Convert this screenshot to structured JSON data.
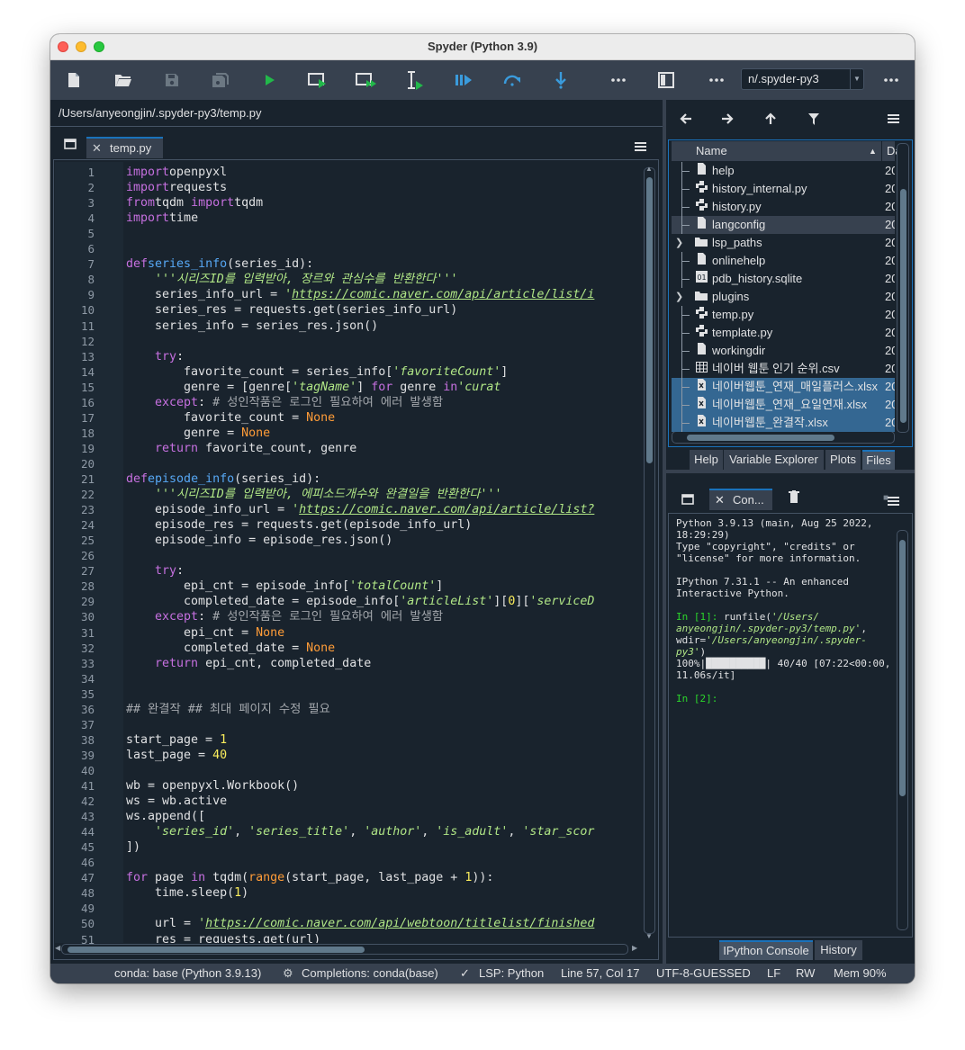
{
  "window": {
    "title": "Spyder (Python 3.9)"
  },
  "toolbar": {
    "working_dir": "n/.spyder-py3"
  },
  "editor": {
    "path": "/Users/anyeongjin/.spyder-py3/temp.py",
    "tab_label": "temp.py",
    "lines": [
      [
        [
          "kw",
          "import"
        ],
        [
          "",
          "openpyxl"
        ]
      ],
      [
        [
          "kw",
          "import"
        ],
        [
          "",
          "requests"
        ]
      ],
      [
        [
          "kw",
          "from"
        ],
        [
          "",
          "tqdm "
        ],
        [
          "kw",
          "import"
        ],
        [
          "",
          "tqdm"
        ]
      ],
      [
        [
          "kw",
          "import"
        ],
        [
          "",
          "time"
        ]
      ],
      [],
      [],
      [
        [
          "kw",
          "def"
        ],
        [
          "fn",
          "series_info"
        ],
        [
          "",
          "(series_id):"
        ]
      ],
      [
        [
          "",
          "    "
        ],
        [
          "st",
          "'''시리즈ID를 입력받아, 장르와 관심수를 반환한다'''"
        ]
      ],
      [
        [
          "",
          "    series_info_url = "
        ],
        [
          "st",
          "'"
        ],
        [
          "st url",
          "https://comic.naver.com/api/article/list/i"
        ]
      ],
      [
        [
          "",
          "    series_res = requests.get(series_info_url)"
        ]
      ],
      [
        [
          "",
          "    series_info = series_res.json()"
        ]
      ],
      [],
      [
        [
          "",
          "    "
        ],
        [
          "kw",
          "try"
        ],
        [
          "",
          ":"
        ]
      ],
      [
        [
          "",
          "        favorite_count = series_info["
        ],
        [
          "st",
          "'favoriteCount'"
        ],
        [
          "",
          "]"
        ]
      ],
      [
        [
          "",
          "        genre = [genre["
        ],
        [
          "st",
          "'tagName'"
        ],
        [
          "",
          "] "
        ],
        [
          "kw",
          "for"
        ],
        [
          "",
          " genre "
        ],
        [
          "kw",
          "in"
        ],
        [
          "",
          "",
          " series_info["
        ],
        [
          "st",
          "'curat"
        ]
      ],
      [
        [
          "",
          "    "
        ],
        [
          "kw",
          "except"
        ],
        [
          "",
          ": "
        ],
        [
          "cm",
          "# 성인작품은 로그인 필요하여 에러 발생함"
        ]
      ],
      [
        [
          "",
          "        favorite_count = "
        ],
        [
          "bu",
          "None"
        ]
      ],
      [
        [
          "",
          "        genre = "
        ],
        [
          "bu",
          "None"
        ]
      ],
      [
        [
          "",
          "    "
        ],
        [
          "kw",
          "return"
        ],
        [
          "",
          " favorite_count, genre"
        ]
      ],
      [],
      [
        [
          "kw",
          "def"
        ],
        [
          "fn",
          "episode_info"
        ],
        [
          "",
          "(series_id):"
        ]
      ],
      [
        [
          "",
          "    "
        ],
        [
          "st",
          "'''시리즈ID를 입력받아, 에피소드개수와 완결일을 반환한다'''"
        ]
      ],
      [
        [
          "",
          "    episode_info_url = "
        ],
        [
          "st",
          "'"
        ],
        [
          "st url",
          "https://comic.naver.com/api/article/list?"
        ]
      ],
      [
        [
          "",
          "    episode_res = requests.get(episode_info_url)"
        ]
      ],
      [
        [
          "",
          "    episode_info = episode_res.json()"
        ]
      ],
      [],
      [
        [
          "",
          "    "
        ],
        [
          "kw",
          "try"
        ],
        [
          "",
          ":"
        ]
      ],
      [
        [
          "",
          "        epi_cnt = episode_info["
        ],
        [
          "st",
          "'totalCount'"
        ],
        [
          "",
          "]"
        ]
      ],
      [
        [
          "",
          "        completed_date = episode_info["
        ],
        [
          "st",
          "'articleList'"
        ],
        [
          "",
          "]["
        ],
        [
          "nu",
          "0"
        ],
        [
          "",
          "]["
        ],
        [
          "st",
          "'serviceD"
        ]
      ],
      [
        [
          "",
          "    "
        ],
        [
          "kw",
          "except"
        ],
        [
          "",
          ": "
        ],
        [
          "cm",
          "# 성인작품은 로그인 필요하여 에러 발생함"
        ]
      ],
      [
        [
          "",
          "        epi_cnt = "
        ],
        [
          "bu",
          "None"
        ]
      ],
      [
        [
          "",
          "        completed_date = "
        ],
        [
          "bu",
          "None"
        ]
      ],
      [
        [
          "",
          "    "
        ],
        [
          "kw",
          "return"
        ],
        [
          "",
          " epi_cnt, completed_date"
        ]
      ],
      [],
      [],
      [
        [
          "cm",
          "## 완결작 ## 최대 페이지 수정 필요"
        ]
      ],
      [],
      [
        [
          "",
          "start_page = "
        ],
        [
          "nu",
          "1"
        ]
      ],
      [
        [
          "",
          "last_page = "
        ],
        [
          "nu",
          "40"
        ]
      ],
      [],
      [
        [
          "",
          "wb = openpyxl.Workbook()"
        ]
      ],
      [
        [
          "",
          "ws = wb.active"
        ]
      ],
      [
        [
          "",
          "ws.append(["
        ]
      ],
      [
        [
          "",
          "    "
        ],
        [
          "st",
          "'series_id'"
        ],
        [
          "",
          ", "
        ],
        [
          "st",
          "'series_title'"
        ],
        [
          "",
          ", "
        ],
        [
          "st",
          "'author'"
        ],
        [
          "",
          ", "
        ],
        [
          "st",
          "'is_adult'"
        ],
        [
          "",
          ", "
        ],
        [
          "st",
          "'star_scor"
        ]
      ],
      [
        [
          "",
          "])"
        ]
      ],
      [],
      [
        [
          "kw",
          "for"
        ],
        [
          "",
          " page "
        ],
        [
          "kw",
          "in"
        ],
        [
          "",
          " tqdm("
        ],
        [
          "bu",
          "range"
        ],
        [
          "",
          "(start_page, last_page + "
        ],
        [
          "nu",
          "1"
        ],
        [
          "",
          "))"
        ],
        [
          "",
          ":"
        ]
      ],
      [
        [
          "",
          "    time.sleep("
        ],
        [
          "nu",
          "1"
        ],
        [
          "",
          ")"
        ]
      ],
      [],
      [
        [
          "",
          "    url = "
        ],
        [
          "st",
          "'"
        ],
        [
          "st url",
          "https://comic.naver.com/api/webtoon/titlelist/finished"
        ]
      ],
      [
        [
          "",
          "    res = requests.get(url)"
        ]
      ]
    ]
  },
  "files": {
    "col_name": "Name",
    "col_date": "Da",
    "items": [
      {
        "name": "help",
        "icon": "file",
        "date": "20"
      },
      {
        "name": "history_internal.py",
        "icon": "python",
        "date": "20"
      },
      {
        "name": "history.py",
        "icon": "python",
        "date": "20"
      },
      {
        "name": "langconfig",
        "icon": "file",
        "date": "20"
      },
      {
        "name": "lsp_paths",
        "icon": "folder",
        "date": "20"
      },
      {
        "name": "onlinehelp",
        "icon": "file",
        "date": "20"
      },
      {
        "name": "pdb_history.sqlite",
        "icon": "db",
        "date": "20"
      },
      {
        "name": "plugins",
        "icon": "folder",
        "date": "20"
      },
      {
        "name": "temp.py",
        "icon": "python",
        "date": "20"
      },
      {
        "name": "template.py",
        "icon": "python",
        "date": "20"
      },
      {
        "name": "workingdir",
        "icon": "file",
        "date": "20"
      },
      {
        "name": "네이버 웹툰 인기 순위.csv",
        "icon": "table",
        "date": "20"
      },
      {
        "name": "네이버웹툰_연재_매일플러스.xlsx",
        "icon": "excel",
        "date": "20"
      },
      {
        "name": "네이버웹툰_연재_요일연재.xlsx",
        "icon": "excel",
        "date": "20"
      },
      {
        "name": "네이버웹툰_완결작.xlsx",
        "icon": "excel",
        "date": "20"
      }
    ]
  },
  "top_tabs": [
    "Help",
    "Variable Explorer",
    "Plots",
    "Files"
  ],
  "console": {
    "tab_label": "Con...",
    "lines": [
      [
        [
          "",
          "Python 3.9.13 (main, Aug 25 2022,"
        ]
      ],
      [
        [
          "",
          "18:29:29)"
        ]
      ],
      [
        [
          "",
          "Type \"copyright\", \"credits\" or"
        ]
      ],
      [
        [
          "",
          "\"license\" for more information."
        ]
      ],
      [],
      [
        [
          "",
          "IPython 7.31.1 -- An enhanced"
        ]
      ],
      [
        [
          "",
          "Interactive Python."
        ]
      ],
      [],
      [
        [
          "cg",
          "In [1]: "
        ],
        [
          "",
          "runfile("
        ],
        [
          "ci",
          "'/Users/"
        ]
      ],
      [
        [
          "ci",
          "anyeongjin/.spyder-py3/temp.py'"
        ],
        [
          "",
          ","
        ]
      ],
      [
        [
          "",
          "wdir="
        ],
        [
          "ci",
          "'/Users/anyeongjin/.spyder-"
        ]
      ],
      [
        [
          "ci",
          "py3'"
        ],
        [
          "",
          ")"
        ]
      ],
      [
        [
          "",
          "100%|██████████| 40/40 [07:22<00:00,"
        ]
      ],
      [
        [
          "",
          "11.06s/it]"
        ]
      ],
      [],
      [
        [
          "cg",
          "In [2]:"
        ]
      ]
    ]
  },
  "bottom_tabs": [
    "IPython Console",
    "History"
  ],
  "status": {
    "env": "conda: base (Python 3.9.13)",
    "completions": "Completions: conda(base)",
    "lsp": "LSP: Python",
    "position": "Line 57, Col 17",
    "encoding": "UTF-8-GUESSED",
    "eol": "LF",
    "perm": "RW",
    "mem": "Mem 90%"
  }
}
